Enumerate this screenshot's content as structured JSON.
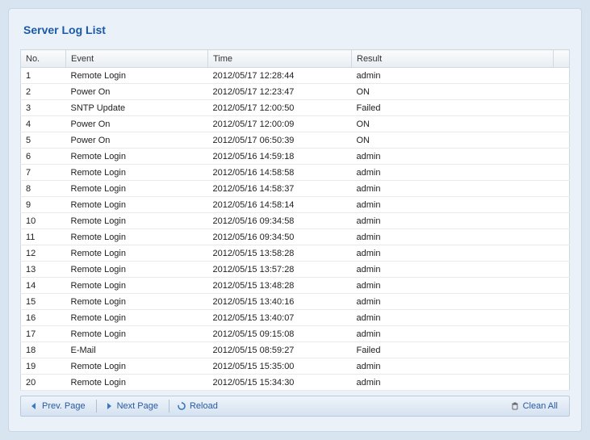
{
  "title": "Server Log List",
  "columns": {
    "no": "No.",
    "event": "Event",
    "time": "Time",
    "result": "Result"
  },
  "rows": [
    {
      "no": "1",
      "event": "Remote Login",
      "time": "2012/05/17 12:28:44",
      "result": "admin"
    },
    {
      "no": "2",
      "event": "Power On",
      "time": "2012/05/17 12:23:47",
      "result": "ON"
    },
    {
      "no": "3",
      "event": "SNTP Update",
      "time": "2012/05/17 12:00:50",
      "result": "Failed"
    },
    {
      "no": "4",
      "event": "Power On",
      "time": "2012/05/17 12:00:09",
      "result": "ON"
    },
    {
      "no": "5",
      "event": "Power On",
      "time": "2012/05/17 06:50:39",
      "result": "ON"
    },
    {
      "no": "6",
      "event": "Remote Login",
      "time": "2012/05/16 14:59:18",
      "result": "admin"
    },
    {
      "no": "7",
      "event": "Remote Login",
      "time": "2012/05/16 14:58:58",
      "result": "admin"
    },
    {
      "no": "8",
      "event": "Remote Login",
      "time": "2012/05/16 14:58:37",
      "result": "admin"
    },
    {
      "no": "9",
      "event": "Remote Login",
      "time": "2012/05/16 14:58:14",
      "result": "admin"
    },
    {
      "no": "10",
      "event": "Remote Login",
      "time": "2012/05/16 09:34:58",
      "result": "admin"
    },
    {
      "no": "11",
      "event": "Remote Login",
      "time": "2012/05/16 09:34:50",
      "result": "admin"
    },
    {
      "no": "12",
      "event": "Remote Login",
      "time": "2012/05/15 13:58:28",
      "result": "admin"
    },
    {
      "no": "13",
      "event": "Remote Login",
      "time": "2012/05/15 13:57:28",
      "result": "admin"
    },
    {
      "no": "14",
      "event": "Remote Login",
      "time": "2012/05/15 13:48:28",
      "result": "admin"
    },
    {
      "no": "15",
      "event": "Remote Login",
      "time": "2012/05/15 13:40:16",
      "result": "admin"
    },
    {
      "no": "16",
      "event": "Remote Login",
      "time": "2012/05/15 13:40:07",
      "result": "admin"
    },
    {
      "no": "17",
      "event": "Remote Login",
      "time": "2012/05/15 09:15:08",
      "result": "admin"
    },
    {
      "no": "18",
      "event": "E-Mail",
      "time": "2012/05/15 08:59:27",
      "result": "Failed"
    },
    {
      "no": "19",
      "event": "Remote Login",
      "time": "2012/05/15 15:35:00",
      "result": "admin"
    },
    {
      "no": "20",
      "event": "Remote Login",
      "time": "2012/05/15 15:34:30",
      "result": "admin"
    }
  ],
  "toolbar": {
    "prev": "Prev. Page",
    "next": "Next Page",
    "reload": "Reload",
    "clean": "Clean All"
  }
}
